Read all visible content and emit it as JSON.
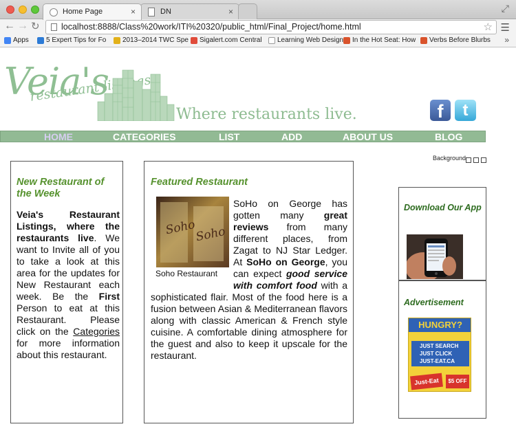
{
  "browser": {
    "tabs": [
      {
        "title": "Home Page",
        "active": true
      },
      {
        "title": "DN",
        "active": false
      }
    ],
    "url": "localhost:8888/Class%20work/ITI%20320/public_html/Final_Project/home.html",
    "bookmarks": [
      {
        "label": "Apps",
        "color": "#4285f4"
      },
      {
        "label": "5 Expert Tips for Fo",
        "color": "#2d7bd6"
      },
      {
        "label": "2013–2014 TWC Spe",
        "color": "#2b2b2b"
      },
      {
        "label": "Sigalert.com Central",
        "color": "#e04b3a"
      },
      {
        "label": "Learning Web Design",
        "color": "#bcbcbc"
      },
      {
        "label": "In the Hot Seat: How",
        "color": "#d9532c"
      },
      {
        "label": "Verbs Before Blurbs",
        "color": "#d9532c"
      }
    ]
  },
  "site": {
    "logo": "Veia's",
    "logo_sub": "restaurant listings",
    "tagline": "Where restaurants live.",
    "nav": [
      {
        "label": "HOME",
        "active": true
      },
      {
        "label": "CATEGORIES",
        "active": false
      },
      {
        "label": "LIST",
        "active": false
      },
      {
        "label": "ADD",
        "active": false
      },
      {
        "label": "ABOUT US",
        "active": false
      },
      {
        "label": "BLOG",
        "active": false
      }
    ],
    "background_label": "Background",
    "new_restaurant": {
      "title": "New Restaurant of the Week",
      "intro_bold": "Veia's Restaurant Listings, where the restaurants live",
      "text1": ". We want to Invite all of you to take a look at this area for the updates for New Restaurant each week. Be the ",
      "first_bold": "First",
      "text2": " Person to eat at this Restaurant. Please click on the ",
      "categories_link": "Categories",
      "text3": " for more information about this restaurant."
    },
    "featured": {
      "title": "Featured Restaurant",
      "photo_caption": "Soho Restaurant",
      "p1": "SoHo on George has gotten many ",
      "b1": "great reviews",
      "p2": " from many different places, from Zagat to NJ Star Ledger. At ",
      "b2": "SoHo on George",
      "p3": ", you can expect ",
      "bi1": "good service with comfort food",
      "p4": " with a sophisticated flair. Most of the food here is a fusion between Asian & Mediterranean flavors along with classic American & French style cuisine. A comfortable dining atmosphere for the guest and also to keep it upscale for the restaurant."
    },
    "download": {
      "title": "Download Our App"
    },
    "advert": {
      "title": "Advertisement",
      "ad_headline": "HUNGRY?",
      "ad_lines": [
        "JUST SEARCH",
        "JUST CLICK",
        "JUST-EAT.CA"
      ],
      "ad_brand": "Just-Eat",
      "ad_price": "$5 OFF"
    }
  }
}
